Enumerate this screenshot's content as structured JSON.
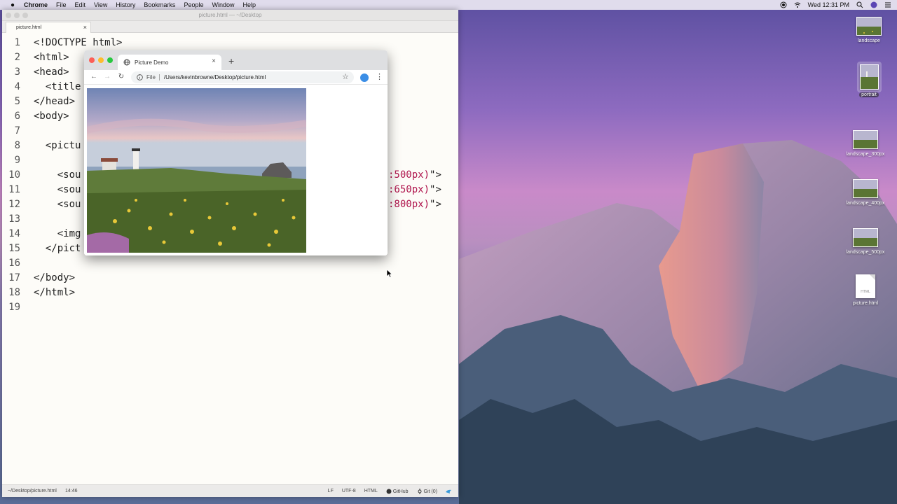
{
  "menubar": {
    "app_name": "Chrome",
    "items": [
      "File",
      "Edit",
      "View",
      "History",
      "Bookmarks",
      "People",
      "Window",
      "Help"
    ],
    "clock": "Wed 12:31 PM"
  },
  "editor": {
    "window_title": "picture.html — ~/Desktop",
    "tab_label": "picture.html",
    "lines": [
      {
        "num": "1",
        "text": "<!DOCTYPE html>"
      },
      {
        "num": "2",
        "text": "<html>"
      },
      {
        "num": "3",
        "text": "<head>"
      },
      {
        "num": "4",
        "text": "  <title"
      },
      {
        "num": "5",
        "text": "</head>"
      },
      {
        "num": "6",
        "text": "<body>"
      },
      {
        "num": "7",
        "text": ""
      },
      {
        "num": "8",
        "text": "  <pictu"
      },
      {
        "num": "9",
        "text": ""
      },
      {
        "num": "10",
        "text": "    <sou"
      },
      {
        "num": "11",
        "text": "    <sou"
      },
      {
        "num": "12",
        "text": "    <sou"
      },
      {
        "num": "13",
        "text": ""
      },
      {
        "num": "14",
        "text": "    <img"
      },
      {
        "num": "15",
        "text": "  </pict"
      },
      {
        "num": "16",
        "text": ""
      },
      {
        "num": "17",
        "text": "</body>"
      },
      {
        "num": "18",
        "text": "</html>"
      },
      {
        "num": "19",
        "text": ""
      }
    ],
    "hidden_tails": [
      {
        "value": ":500px)",
        "close": "\">"
      },
      {
        "value": ":650px)",
        "close": "\">"
      },
      {
        "value": ":800px)",
        "close": "\">"
      }
    ],
    "status": {
      "path": "~/Desktop/picture.html",
      "cursor": "14:46",
      "line_ending": "LF",
      "encoding": "UTF-8",
      "grammar": "HTML",
      "github": "GitHub",
      "git": "Git (0)"
    }
  },
  "browser": {
    "tab_title": "Picture Demo",
    "scheme_label": "File",
    "url": "/Users/kevinbrowne/Desktop/picture.html",
    "traffic_colors": {
      "close": "#fc5f57",
      "minimize": "#fdbc2e",
      "zoom": "#28c840"
    }
  },
  "desktop_icons": [
    {
      "label": "landscape",
      "kind": "landscape-thumbnail",
      "selected": false
    },
    {
      "label": "portrait",
      "kind": "portrait-thumbnail",
      "selected": true
    },
    {
      "label": "landscape_300px",
      "kind": "landscape-thumbnail",
      "selected": false
    },
    {
      "label": "landscape_400px",
      "kind": "landscape-thumbnail",
      "selected": false
    },
    {
      "label": "landscape_500px",
      "kind": "landscape-thumbnail",
      "selected": false
    },
    {
      "label": "picture.html",
      "kind": "html-document",
      "badge": "HTML",
      "selected": false
    }
  ],
  "colors": {
    "code_string": "#b0174e",
    "code_text": "#222222",
    "editor_bg": "#fdfcf8"
  }
}
